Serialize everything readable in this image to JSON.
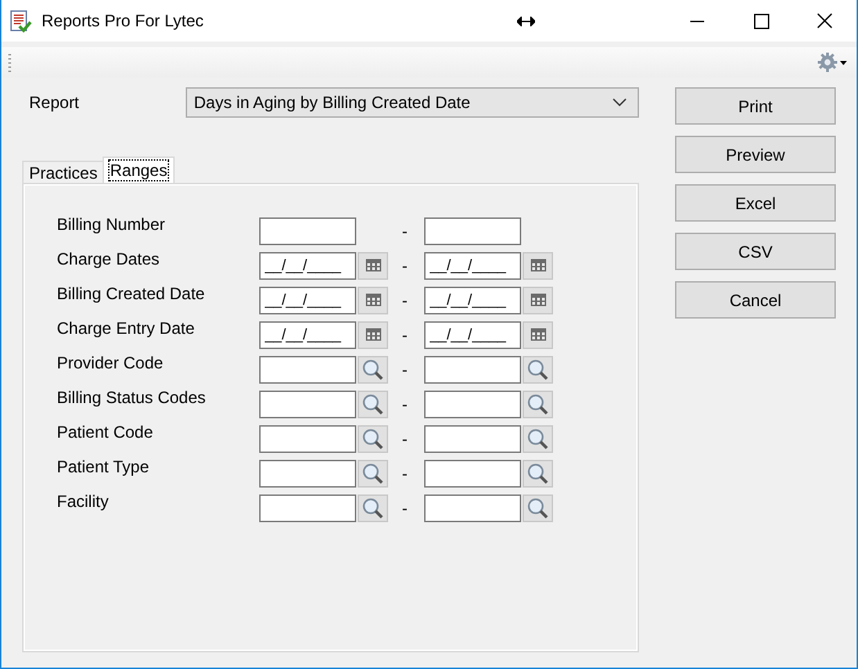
{
  "window": {
    "title": "Reports Pro For Lytec"
  },
  "report": {
    "label": "Report",
    "value": "Days in Aging by Billing Created Date"
  },
  "buttons": [
    {
      "label": "Print"
    },
    {
      "label": "Preview"
    },
    {
      "label": "Excel"
    },
    {
      "label": "CSV"
    },
    {
      "label": "Cancel"
    }
  ],
  "tabs": [
    {
      "label": "Practices",
      "selected": false
    },
    {
      "label": "Ranges",
      "selected": true
    }
  ],
  "ranges": [
    {
      "label": "Billing Number",
      "kind": "text",
      "separator": "-"
    },
    {
      "label": "Charge Dates",
      "kind": "date",
      "from": "__/__/____",
      "to": "__/__/____",
      "separator": "-"
    },
    {
      "label": "Billing Created Date",
      "kind": "date",
      "from": "__/__/____",
      "to": "__/__/____",
      "separator": "-"
    },
    {
      "label": "Charge Entry Date",
      "kind": "date",
      "from": "__/__/____",
      "to": "__/__/____",
      "separator": "-"
    },
    {
      "label": "Provider Code",
      "kind": "lookup",
      "separator": "-"
    },
    {
      "label": "Billing Status Codes",
      "kind": "lookup",
      "separator": "-"
    },
    {
      "label": "Patient Code",
      "kind": "lookup",
      "separator": "-"
    },
    {
      "label": "Patient Type",
      "kind": "lookup",
      "separator": "-"
    },
    {
      "label": "Facility",
      "kind": "lookup",
      "separator": "-"
    }
  ]
}
